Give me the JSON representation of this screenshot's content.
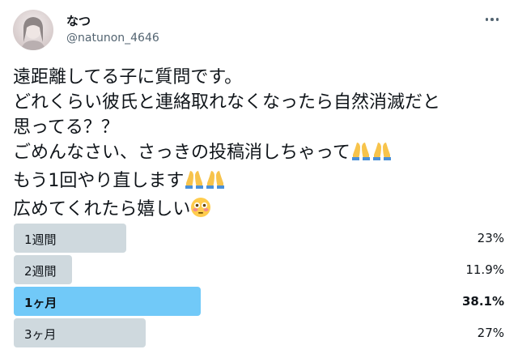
{
  "author": {
    "display_name": "なつ",
    "handle": "@natunon_4646"
  },
  "icons": {
    "more": "more-horizontal-icon",
    "folded_hands": "folded-hands-emoji",
    "flushed_face": "flushed-face-emoji"
  },
  "tweet": {
    "line1": "遠距離してる子に質問です。",
    "line2": "どれくらい彼氏と連絡取れなくなったら自然消滅だと",
    "line3": "思ってる？？",
    "line4": "ごめんなさい、さっきの投稿消しちゃって",
    "line5": "もう1回やり直します",
    "line6": "広めてくれたら嬉しい"
  },
  "colors": {
    "bar": "#cfd9de",
    "winner_bar": "#71c9f8"
  },
  "poll": {
    "options": [
      {
        "label": "1週間",
        "percent": "23%",
        "value": 23
      },
      {
        "label": "2週間",
        "percent": "11.9%",
        "value": 11.9
      },
      {
        "label": "1ヶ月",
        "percent": "38.1%",
        "value": 38.1,
        "winner": true
      },
      {
        "label": "3ヶ月",
        "percent": "27%",
        "value": 27
      }
    ]
  }
}
